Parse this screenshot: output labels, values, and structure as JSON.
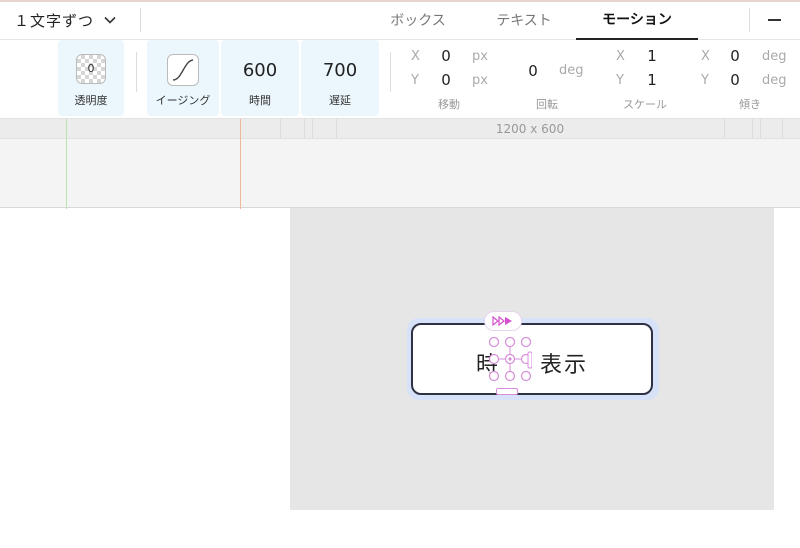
{
  "header": {
    "split_mode": "１文字ずつ",
    "tabs": [
      {
        "label": "ボックス",
        "active": false
      },
      {
        "label": "テキスト",
        "active": false
      },
      {
        "label": "モーション",
        "active": true
      }
    ]
  },
  "toolbar": {
    "opacity": {
      "value": "0",
      "label": "透明度"
    },
    "easing": {
      "label": "イージング"
    },
    "duration": {
      "value": "600",
      "label": "時間"
    },
    "delay": {
      "value": "700",
      "label": "遅延"
    },
    "move": {
      "x": "0",
      "y": "0",
      "unit_x": "px",
      "unit_y": "px",
      "label": "移動"
    },
    "rotate": {
      "value": "0",
      "unit": "deg",
      "label": "回転"
    },
    "scale": {
      "x": "1",
      "y": "1",
      "label": "スケール"
    },
    "skew": {
      "x": "0",
      "y": "0",
      "unit_x": "deg",
      "unit_y": "deg",
      "label": "傾き"
    },
    "axis_x": "X",
    "axis_y": "Y"
  },
  "ruler": {
    "canvas_size": "1200 x 600"
  },
  "canvas": {
    "box_text_before": "時",
    "box_text_after": "表示"
  },
  "colors": {
    "active_card": "#ebf7fd",
    "handle": "#d68ed8",
    "play": "#d64fcf",
    "box_border": "#2f3245"
  }
}
